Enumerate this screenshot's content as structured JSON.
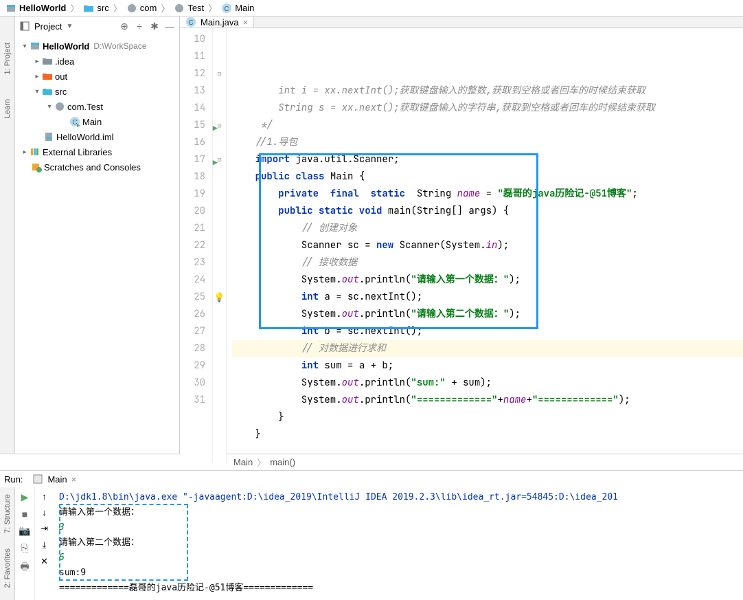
{
  "breadcrumb": {
    "items": [
      {
        "icon": "module",
        "label": "HelloWorld",
        "bold": true
      },
      {
        "icon": "folder",
        "label": "src"
      },
      {
        "icon": "package",
        "label": "com"
      },
      {
        "icon": "package",
        "label": "Test"
      },
      {
        "icon": "class",
        "label": "Main"
      }
    ]
  },
  "toolwindow": {
    "title": "Project"
  },
  "project_tree": {
    "root": {
      "label": "HelloWorld",
      "path": "D:\\WorkSpace"
    },
    "idea": ".idea",
    "out": "out",
    "src": "src",
    "pkg": "com.Test",
    "main": "Main",
    "iml": "HelloWorld.iml",
    "ext": "External Libraries",
    "scratch": "Scratches and Consoles"
  },
  "tab": {
    "name": "Main.java"
  },
  "code": {
    "line_start": 10,
    "lines": [
      {
        "n": 10,
        "html": "        <span class='com'>int i = xx.nextInt();获取键盘输入的整数,获取到空格或者回车的时候结束获取</span>"
      },
      {
        "n": 11,
        "html": "        <span class='com'>String s = xx.next();获取键盘输入的字符串,获取到空格或者回车的时候结束获取</span>"
      },
      {
        "n": 12,
        "html": "     <span class='com'>*/</span>",
        "marker": "fold"
      },
      {
        "n": 13,
        "html": "    <span class='com'>//1.导包</span>"
      },
      {
        "n": 14,
        "html": "    <span class='kw'>import</span> java.util.Scanner;"
      },
      {
        "n": 15,
        "html": "    <span class='kw'>public class</span> <span class='cls'>Main</span> {",
        "run": true,
        "marker": "fold"
      },
      {
        "n": 16,
        "html": "        <span class='kw'>private  final  static</span>  String <span class='fld'>name</span> = <span class='str'>\"磊哥的java历险记-@51博客\"</span>;"
      },
      {
        "n": 17,
        "html": "        <span class='kw'>public static void</span> main(String[] args) {",
        "run": true,
        "marker": "fold"
      },
      {
        "n": 18,
        "html": "            <span class='com'>// 创建对象</span>"
      },
      {
        "n": 19,
        "html": "            Scanner sc = <span class='kw'>new</span> Scanner(System.<span class='fld'>in</span>);"
      },
      {
        "n": 20,
        "html": "            <span class='com'>// 接收数据</span>"
      },
      {
        "n": 21,
        "html": "            System.<span class='fld'>out</span>.println(<span class='str'>\"请输<b>入第一个数据：</b>\"</span>);"
      },
      {
        "n": 22,
        "html": "            <span class='kw'>int</span> a = sc.nextInt();"
      },
      {
        "n": 23,
        "html": "            System.<span class='fld'>out</span>.println(<span class='str'>\"请输<b>入第二个数据：</b>\"</span>);"
      },
      {
        "n": 24,
        "html": "            <span class='kw'>int</span> b = sc.nextInt();"
      },
      {
        "n": 25,
        "html": "            <span class='com'>// 对数据进行求和</span>",
        "hl": true,
        "marker": "bulb"
      },
      {
        "n": 26,
        "html": "            <span class='kw'>int</span> sum = a + b;"
      },
      {
        "n": 27,
        "html": "            System.<span class='fld'>out</span>.println(<span class='str'>\"sum:\"</span> + sum);"
      },
      {
        "n": 28,
        "html": "            System.<span class='fld'>out</span>.println(<span class='str'>\"=============\"</span>+<span class='fld'>name</span>+<span class='str'>\"=============\"</span>);"
      },
      {
        "n": 29,
        "html": "        }"
      },
      {
        "n": 30,
        "html": "    }"
      },
      {
        "n": 31,
        "html": ""
      }
    ]
  },
  "editor_breadcrumb": {
    "items": [
      "Main",
      "main()"
    ]
  },
  "run": {
    "title": "Run:",
    "tab": "Main",
    "cmd": "D:\\jdk1.8\\bin\\java.exe \"-javaagent:D:\\idea_2019\\IntelliJ IDEA 2019.2.3\\lib\\idea_rt.jar=54845:D:\\idea_201",
    "lines": [
      {
        "text": "请输入第一个数据：",
        "cls": ""
      },
      {
        "text": "3",
        "cls": "out-green"
      },
      {
        "text": "请输入第二个数据：",
        "cls": ""
      },
      {
        "text": "6",
        "cls": "out-green"
      },
      {
        "text": "sum:9",
        "cls": ""
      },
      {
        "text": "=============磊哥的java历险记-@51博客=============",
        "cls": ""
      }
    ]
  },
  "side_tabs": {
    "project": "1: Project",
    "learn": "Learn",
    "structure": "7: Structure",
    "favorites": "2: Favorites"
  }
}
